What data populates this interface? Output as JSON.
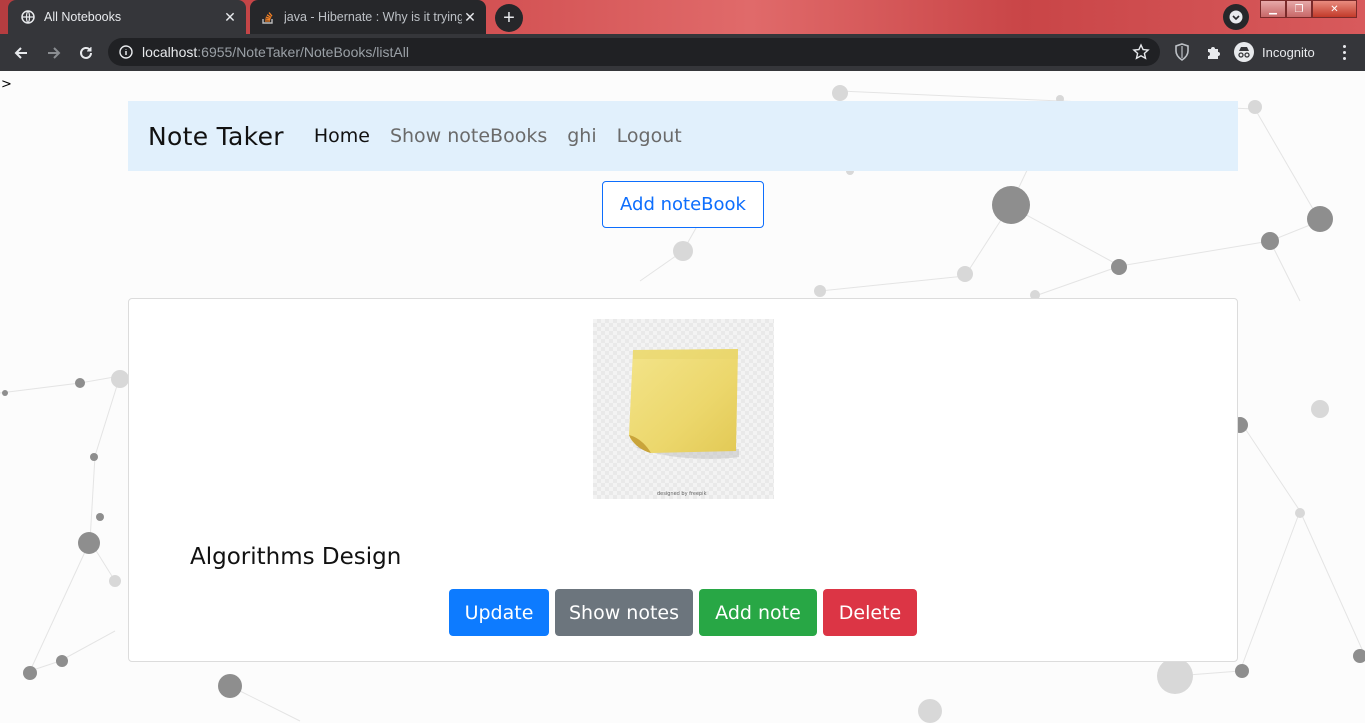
{
  "browser": {
    "tabs": [
      {
        "title": "All Notebooks",
        "active": true,
        "icon": "globe-icon"
      },
      {
        "title": "java - Hibernate : Why is it trying",
        "active": false,
        "icon": "stackoverflow-icon"
      }
    ],
    "new_tab_label": "+",
    "address": {
      "host": "localhost",
      "rest": ":6955/NoteTaker/NoteBooks/listAll"
    },
    "profile_label": "Incognito",
    "colors": {
      "titlebar": "#cf4a4c",
      "toolbar": "#35363a",
      "omnibox": "#202124"
    }
  },
  "page": {
    "stray_text": ">",
    "navbar": {
      "brand": "Note Taker",
      "links": [
        {
          "label": "Home",
          "active": true
        },
        {
          "label": "Show noteBooks",
          "active": false
        },
        {
          "label": "ghi",
          "active": false
        },
        {
          "label": "Logout",
          "active": false
        }
      ],
      "background": "#e1f0fc"
    },
    "add_notebook_label": "Add noteBook",
    "notebook": {
      "title": "Algorithms Design",
      "image_icon": "sticky-note-icon",
      "image_credit": "designed by freepik",
      "buttons": [
        {
          "label": "Update",
          "color": "#0d7bff"
        },
        {
          "label": "Show notes",
          "color": "#6c757d"
        },
        {
          "label": "Add note",
          "color": "#28a745"
        },
        {
          "label": "Delete",
          "color": "#dc3545"
        }
      ]
    }
  }
}
